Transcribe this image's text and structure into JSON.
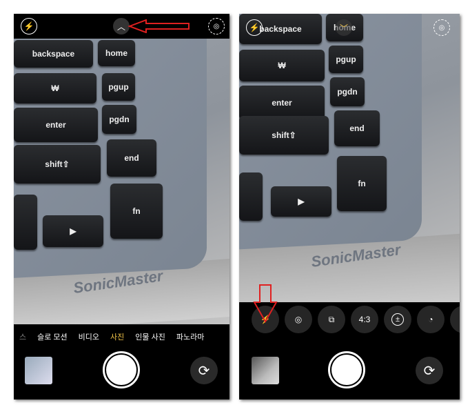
{
  "left_screen": {
    "top_bar": {
      "flash_icon": "flash-off-icon",
      "expand_icon": "chevron-up-icon",
      "live_icon": "live-photo-off-icon"
    },
    "keys": {
      "backspace": "backspace",
      "home": "home",
      "won": "₩",
      "pgup": "pgup",
      "enter": "enter",
      "pgdn": "pgdn",
      "shift": "shift⇧",
      "end": "end",
      "fn": "fn",
      "play": "▶"
    },
    "brand": "SonicMaster",
    "modes": [
      "스",
      "슬로 모션",
      "비디오",
      "사진",
      "인물 사진",
      "파노라마"
    ],
    "active_mode": "사진",
    "active_color": "#f5c74a"
  },
  "right_screen": {
    "keys": {
      "backspace": "backspace",
      "home": "home",
      "won": "₩",
      "pgup": "pgup",
      "enter": "enter",
      "pgdn": "pgdn",
      "shift": "shift⇧",
      "end": "end",
      "fn": "fn",
      "play": "▶"
    },
    "brand": "SonicMaster",
    "controls": [
      {
        "icon": "flash-off-icon",
        "label": ""
      },
      {
        "icon": "live-photo-off-icon",
        "label": ""
      },
      {
        "icon": "filters-off-icon",
        "label": ""
      },
      {
        "icon": "aspect-ratio-icon",
        "label": "4:3"
      },
      {
        "icon": "exposure-icon",
        "label": "±"
      },
      {
        "icon": "timer-icon",
        "label": ""
      }
    ]
  },
  "annotation_color": "#e02020"
}
